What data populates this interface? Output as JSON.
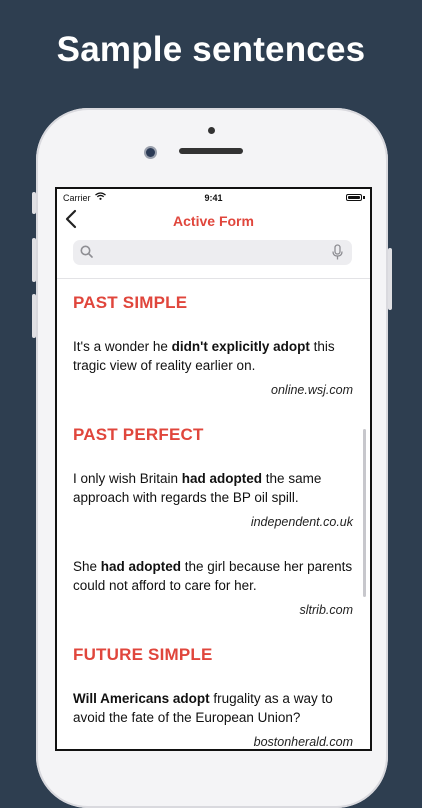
{
  "headline": "Sample sentences",
  "status": {
    "carrier": "Carrier",
    "time": "9:41"
  },
  "nav": {
    "title": "Active Form"
  },
  "search": {
    "placeholder": ""
  },
  "sections": [
    {
      "title": "PAST SIMPLE",
      "entries": [
        {
          "pre": "It's a wonder he ",
          "bold": "didn't explicitly adopt",
          "post": " this tragic view of reality earlier on.",
          "source": "online.wsj.com"
        }
      ]
    },
    {
      "title": "PAST PERFECT",
      "entries": [
        {
          "pre": "I only wish Britain ",
          "bold": "had adopted",
          "post": " the same approach with regards the BP oil spill.",
          "source": "independent.co.uk"
        },
        {
          "pre": "She ",
          "bold": "had adopted",
          "post": " the girl because her parents could not afford to care for her.",
          "source": "sltrib.com"
        }
      ]
    },
    {
      "title": "FUTURE SIMPLE",
      "entries": [
        {
          "pre": "",
          "bold": "Will Americans adopt",
          "post": " frugality as a way to avoid the fate of the European Union?",
          "source": "bostonherald.com"
        }
      ]
    }
  ],
  "colors": {
    "accent": "#e0463c",
    "background": "#2e3e50"
  },
  "icons": {
    "back": "chevron-left-icon",
    "search": "search-icon",
    "mic": "mic-icon",
    "wifi": "wifi-icon",
    "battery": "battery-icon"
  }
}
